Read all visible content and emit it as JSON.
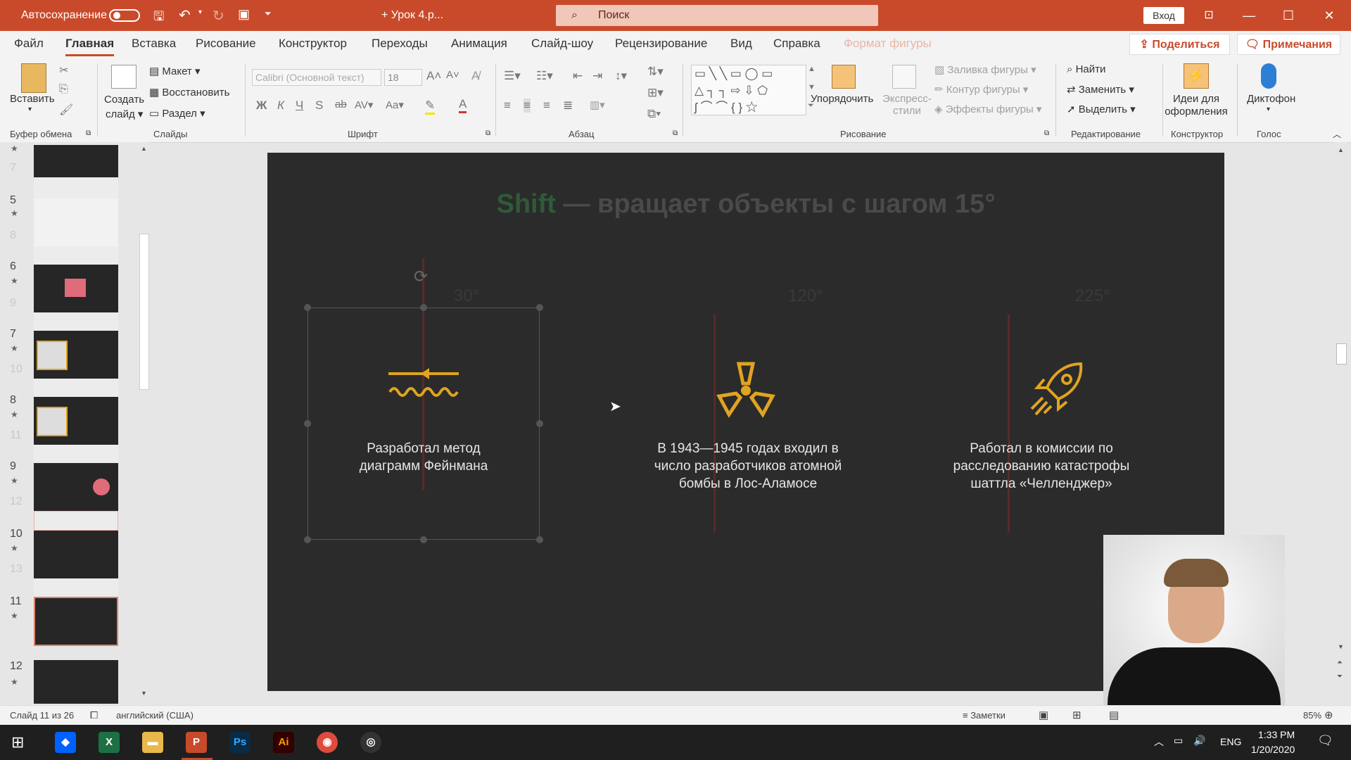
{
  "titlebar": {
    "autosave_label": "Автосохранение",
    "doc_title": "+ Урок 4.р...",
    "search_placeholder": "Поиск",
    "signin_label": "Вход",
    "accent": "#c94a2a"
  },
  "tabs": [
    {
      "label": "Файл"
    },
    {
      "label": "Главная"
    },
    {
      "label": "Вставка"
    },
    {
      "label": "Рисование"
    },
    {
      "label": "Конструктор"
    },
    {
      "label": "Переходы"
    },
    {
      "label": "Анимация"
    },
    {
      "label": "Слайд-шоу"
    },
    {
      "label": "Рецензирование"
    },
    {
      "label": "Вид"
    },
    {
      "label": "Справка"
    },
    {
      "label": "Формат фигуры"
    }
  ],
  "share_label": "Поделиться",
  "notes_label": "Примечания",
  "ribbon": {
    "paste": "Вставить",
    "new_slide": "Создать слайд",
    "layout": "Макет",
    "reset": "Восстановить",
    "section": "Раздел",
    "font_name": "Calibri (Основной текст)",
    "font_size": "18",
    "arrange": "Упорядочить",
    "quick_styles": "Экспресс-стили",
    "fill": "Заливка фигуры",
    "outline": "Контур фигуры",
    "effects": "Эффекты фигуры",
    "find": "Найти",
    "replace": "Заменить",
    "select": "Выделить",
    "ideas": "Идеи для оформления",
    "dictate": "Диктофон",
    "groups": {
      "clipboard": "Буфер обмена",
      "slides": "Слайды",
      "font": "Шрифт",
      "paragraph": "Абзац",
      "drawing": "Рисование",
      "editing": "Редактирование",
      "designer": "Конструктор",
      "voice": "Голос"
    }
  },
  "thumbnails": {
    "numbers": [
      {
        "n": "5",
        "faint": false
      },
      {
        "n": "8",
        "faint": true
      },
      {
        "n": "6",
        "faint": false
      },
      {
        "n": "9",
        "faint": true
      },
      {
        "n": "7",
        "faint": false
      },
      {
        "n": "10",
        "faint": true
      },
      {
        "n": "8",
        "faint": false
      },
      {
        "n": "11",
        "faint": true
      },
      {
        "n": "9",
        "faint": false
      },
      {
        "n": "12",
        "faint": true
      },
      {
        "n": "10",
        "faint": false
      },
      {
        "n": "13",
        "faint": true
      },
      {
        "n": "11",
        "faint": false
      },
      {
        "n": "12",
        "faint": false
      }
    ]
  },
  "slide": {
    "title_accent": "Shift",
    "title_rest": " — вращает объекты с шагом 15°",
    "degrees": [
      "30°",
      "120°",
      "225°"
    ],
    "cards": [
      {
        "text_line1": "Разработал метод",
        "text_line2": "диаграмм Фейнмана",
        "text_line3": ""
      },
      {
        "text_line1": "В 1943—1945 годах входил в",
        "text_line2": "число разработчиков атомной",
        "text_line3": "бомбы в Лос-Аламосе"
      },
      {
        "text_line1": "Работал в комиссии по",
        "text_line2": "расследованию катастрофы",
        "text_line3": "шаттла «Челленджер»"
      }
    ],
    "icon_color": "#e0a420",
    "title_accent_color": "#2f5a3a"
  },
  "status": {
    "slide_info": "Слайд 11 из 26",
    "language": "английский (США)",
    "notes": "Заметки",
    "zoom": "85%"
  },
  "taskbar": {
    "time": "1:33 PM",
    "date": "1/20/2020",
    "lang": "ENG"
  }
}
